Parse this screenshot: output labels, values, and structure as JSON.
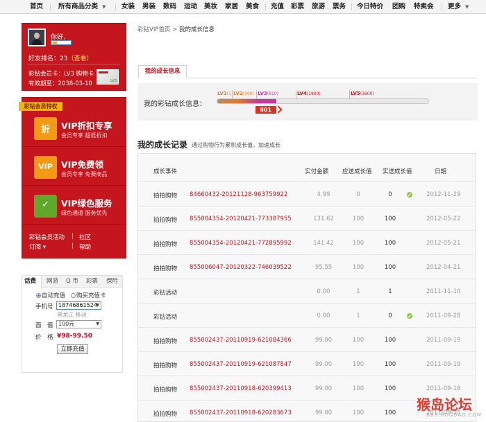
{
  "topnav": {
    "items": [
      "首页",
      "所有商品分类",
      "女装",
      "男装",
      "数码",
      "运动",
      "美妆",
      "家居",
      "美食",
      "充值",
      "彩票",
      "旅游",
      "票务",
      "今日特价",
      "团购",
      "特卖会",
      "更多"
    ]
  },
  "profile": {
    "greeting": "你好,",
    "rank_label": "好友排名：23",
    "rank_link": "（查看）",
    "member_label": "彩钻会员卡：LV3 购物卡",
    "expire_label": "有效期至：2038-03-10"
  },
  "privilege": {
    "tag": "彩钻会员特权",
    "items": [
      {
        "icon": "折",
        "title": "VIP折扣专享",
        "subtitle": "会员专享 超低折扣"
      },
      {
        "icon": "VIP",
        "title": "VIP免费领",
        "subtitle": "会员专享 免费商品"
      },
      {
        "icon": "✓",
        "title": "VIP绿色服务",
        "subtitle": "绿色通道 服务优先"
      }
    ],
    "links": [
      "彩钻会员活动",
      "社区",
      "订阅 ▾",
      "帮助"
    ]
  },
  "recharge": {
    "tabs": [
      "话费",
      "网游",
      "Q 币",
      "彩票",
      "保险"
    ],
    "option_auto": "自动充值",
    "option_card": "购买充值卡",
    "phone_label": "手机号",
    "phone_value": "18746861524",
    "region": "黑龙江 移动",
    "amount_label": "面　值",
    "amount_value": "100元",
    "price_label": "价　格",
    "price_value": "¥98-99.50",
    "button": "立即充值"
  },
  "breadcrumb": {
    "home": "彩钻VIP首页",
    "sep": " > ",
    "current": "我的成长信息"
  },
  "growth": {
    "tab": "我的成长信息",
    "label": "我的彩钻成长信息：",
    "value": "801",
    "progress": 0.28,
    "levels": [
      {
        "name": "LV1",
        "range": "(1)",
        "color": "#b98a5b"
      },
      {
        "name": "LV2",
        "range": "(300)",
        "color": "#e67a27"
      },
      {
        "name": "LV3",
        "range": "(810)",
        "color": "#c33a9a"
      },
      {
        "name": "LV4",
        "range": "(1800)",
        "color": "#c4161c"
      },
      {
        "name": "LV5",
        "range": "(3600)",
        "color": "#c4161c"
      }
    ]
  },
  "records": {
    "title": "我的成长记录",
    "subtitle": "通过购物行为累积成长值，加速成长",
    "columns": [
      "成长事件",
      "实付金额",
      "应送成长值",
      "实送成长值",
      "日期"
    ],
    "rows": [
      {
        "event": "拍拍购物",
        "order": "84660432-20121128-963759922",
        "amount": "4.99",
        "should": "0",
        "actual": "0",
        "ok": true,
        "date": "2012-11-29"
      },
      {
        "event": "拍拍购物",
        "order": "855004354-20120421-773387955",
        "amount": "131.62",
        "should": "100",
        "actual": "100",
        "ok": false,
        "date": "2012-05-22"
      },
      {
        "event": "拍拍购物",
        "order": "855004354-20120421-772895992",
        "amount": "141.42",
        "should": "100",
        "actual": "100",
        "ok": false,
        "date": "2012-05-21"
      },
      {
        "event": "拍拍购物",
        "order": "855006047-20120322-746039522",
        "amount": "95.55",
        "should": "100",
        "actual": "100",
        "ok": false,
        "date": "2012-04-21"
      },
      {
        "event": "彩钻活动",
        "order": "",
        "amount": "0.00",
        "should": "1",
        "actual": "1",
        "ok": false,
        "date": "2011-11-10"
      },
      {
        "event": "彩钻活动",
        "order": "",
        "amount": "0.00",
        "should": "1",
        "actual": "0",
        "ok": true,
        "date": "2011-09-28"
      },
      {
        "event": "拍拍购物",
        "order": "855002437-20110919-621084366",
        "amount": "99.00",
        "should": "100",
        "actual": "100",
        "ok": false,
        "date": "2011-09-19"
      },
      {
        "event": "拍拍购物",
        "order": "855002437-20110919-621087847",
        "amount": "99.00",
        "should": "100",
        "actual": "100",
        "ok": false,
        "date": "2011-09-19"
      },
      {
        "event": "拍拍购物",
        "order": "855002437-20110918-620399413",
        "amount": "99.00",
        "should": "100",
        "actual": "100",
        "ok": false,
        "date": "2011-09-18"
      },
      {
        "event": "拍拍购物",
        "order": "855002437-20110918-620283673",
        "amount": "99.00",
        "should": "100",
        "actual": "100",
        "ok": false,
        "date": "2011-09-18"
      }
    ]
  },
  "watermark": {
    "line1": "猴岛论坛",
    "line2": "BBS.HOUDAO.COM"
  }
}
